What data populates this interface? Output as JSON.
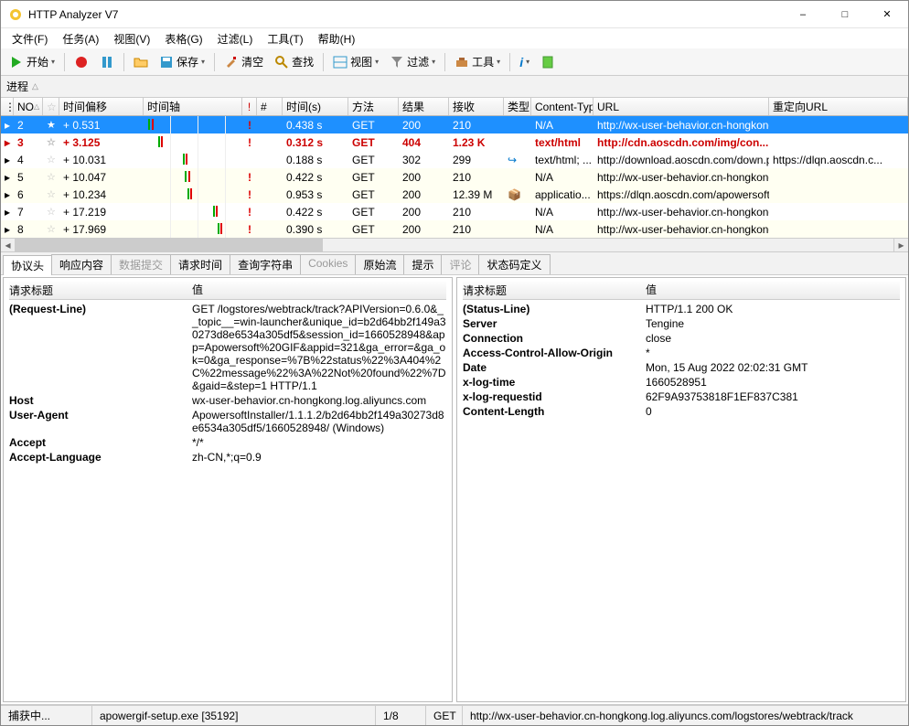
{
  "window": {
    "title": "HTTP Analyzer V7"
  },
  "menu": {
    "file": "文件(F)",
    "task": "任务(A)",
    "view": "视图(V)",
    "grid": "表格(G)",
    "filter": "过滤(L)",
    "tools": "工具(T)",
    "help": "帮助(H)"
  },
  "toolbar": {
    "start": "开始",
    "save": "保存",
    "clear": "清空",
    "find": "查找",
    "view": "视图",
    "filter": "过滤",
    "tools": "工具"
  },
  "filterbar": {
    "process": "进程"
  },
  "grid_headers": {
    "no": "NO",
    "star": "☆",
    "offset": "时间偏移",
    "timeline": "时间轴",
    "excl": "!",
    "hash": "#",
    "duration": "时间(s)",
    "method": "方法",
    "result": "结果",
    "receive": "接收",
    "type": "类型",
    "ctype": "Content-Typ",
    "url": "URL",
    "redirect": "重定向URL"
  },
  "grid_rows": [
    {
      "no": "2",
      "selected": true,
      "star_on": true,
      "offset": "+ 0.531",
      "excl": "!",
      "duration": "0.438 s",
      "method": "GET",
      "result": "200",
      "receive": "210",
      "type_icon": "",
      "ctype": "N/A",
      "url": "http://wx-user-behavior.cn-hongkong.l...",
      "redirect": "",
      "cls": ""
    },
    {
      "no": "3",
      "offset": "+ 3.125",
      "excl": "!",
      "duration": "0.312 s",
      "method": "GET",
      "result": "404",
      "receive": "1.23 K",
      "type_icon": "",
      "ctype": "text/html",
      "url": "http://cdn.aoscdn.com/img/con...",
      "redirect": "",
      "cls": "red"
    },
    {
      "no": "4",
      "offset": "+ 10.031",
      "excl": "",
      "duration": "0.188 s",
      "method": "GET",
      "result": "302",
      "receive": "299",
      "type_icon": "↪",
      "ctype": "text/html; ...",
      "url": "http://download.aoscdn.com/down.ph...",
      "redirect": "https://dlqn.aoscdn.c...",
      "cls": ""
    },
    {
      "no": "5",
      "offset": "+ 10.047",
      "excl": "!",
      "duration": "0.422 s",
      "method": "GET",
      "result": "200",
      "receive": "210",
      "type_icon": "",
      "ctype": "N/A",
      "url": "http://wx-user-behavior.cn-hongkong.l...",
      "redirect": "",
      "cls": "odd"
    },
    {
      "no": "6",
      "offset": "+ 10.234",
      "excl": "!",
      "duration": "0.953 s",
      "method": "GET",
      "result": "200",
      "receive": "12.39 M",
      "type_icon": "📦",
      "ctype": "applicatio...",
      "url": "https://dlqn.aoscdn.com/apowersoft-gi...",
      "redirect": "",
      "cls": "odd"
    },
    {
      "no": "7",
      "offset": "+ 17.219",
      "excl": "!",
      "duration": "0.422 s",
      "method": "GET",
      "result": "200",
      "receive": "210",
      "type_icon": "",
      "ctype": "N/A",
      "url": "http://wx-user-behavior.cn-hongkong.l...",
      "redirect": "",
      "cls": ""
    },
    {
      "no": "8",
      "offset": "+ 17.969",
      "excl": "!",
      "duration": "0.390 s",
      "method": "GET",
      "result": "200",
      "receive": "210",
      "type_icon": "",
      "ctype": "N/A",
      "url": "http://wx-user-behavior.cn-hongkong.l...",
      "redirect": "",
      "cls": "odd"
    }
  ],
  "detail_tabs": {
    "headers": "协议头",
    "content": "响应内容",
    "post": "数据提交",
    "timing": "请求时间",
    "query": "查询字符串",
    "cookies": "Cookies",
    "raw": "原始流",
    "hints": "提示",
    "comments": "评论",
    "status": "状态码定义"
  },
  "left_pane": {
    "header_key": "请求标题",
    "header_val": "值",
    "rows": [
      {
        "k": "(Request-Line)",
        "v": "GET /logstores/webtrack/track?APIVersion=0.6.0&__topic__=win-launcher&unique_id=b2d64bb2f149a30273d8e6534a305df5&session_id=1660528948&app=Apowersoft%20GIF&appid=321&ga_error=&ga_ok=0&ga_response=%7B%22status%22%3A404%2C%22message%22%3A%22Not%20found%22%7D&gaid=&step=1 HTTP/1.1"
      },
      {
        "k": "Host",
        "v": "wx-user-behavior.cn-hongkong.log.aliyuncs.com"
      },
      {
        "k": "User-Agent",
        "v": "ApowersoftInstaller/1.1.1.2/b2d64bb2f149a30273d8e6534a305df5/1660528948/ (Windows)"
      },
      {
        "k": "Accept",
        "v": "*/*"
      },
      {
        "k": "Accept-Language",
        "v": "zh-CN,*;q=0.9"
      }
    ]
  },
  "right_pane": {
    "header_key": "请求标题",
    "header_val": "值",
    "rows": [
      {
        "k": "(Status-Line)",
        "v": "HTTP/1.1 200 OK"
      },
      {
        "k": "Server",
        "v": "Tengine"
      },
      {
        "k": "Connection",
        "v": "close"
      },
      {
        "k": "Access-Control-Allow-Origin",
        "v": "*"
      },
      {
        "k": "Date",
        "v": "Mon, 15 Aug 2022 02:02:31 GMT"
      },
      {
        "k": "x-log-time",
        "v": "1660528951"
      },
      {
        "k": "x-log-requestid",
        "v": "62F9A93753818F1EF837C381"
      },
      {
        "k": "Content-Length",
        "v": "0"
      }
    ]
  },
  "statusbar": {
    "capture": "捕获中...",
    "process": "apowergif-setup.exe [35192]",
    "pos": "1/8",
    "method": "GET",
    "url": "http://wx-user-behavior.cn-hongkong.log.aliyuncs.com/logstores/webtrack/track"
  }
}
